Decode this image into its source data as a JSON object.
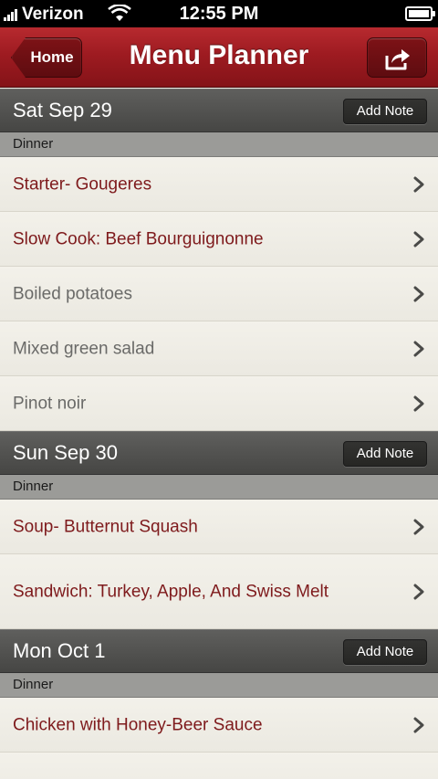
{
  "status_bar": {
    "carrier": "Verizon",
    "time": "12:55 PM"
  },
  "nav": {
    "title": "Menu Planner",
    "home_label": "Home"
  },
  "days": [
    {
      "date": "Sat Sep 29",
      "note_label": "Add Note",
      "meal": "Dinner",
      "items": [
        {
          "label": "Starter- Gougeres",
          "kind": "recipe"
        },
        {
          "label": "Slow Cook: Beef Bourguignonne",
          "kind": "recipe"
        },
        {
          "label": "Boiled potatoes",
          "kind": "plain"
        },
        {
          "label": "Mixed green salad",
          "kind": "plain"
        },
        {
          "label": "Pinot noir",
          "kind": "plain"
        }
      ]
    },
    {
      "date": "Sun Sep 30",
      "note_label": "Add Note",
      "meal": "Dinner",
      "items": [
        {
          "label": "Soup- Butternut Squash",
          "kind": "recipe"
        },
        {
          "label": "Sandwich: Turkey, Apple, And Swiss Melt",
          "kind": "recipe"
        }
      ]
    },
    {
      "date": "Mon Oct 1",
      "note_label": "Add Note",
      "meal": "Dinner",
      "items": [
        {
          "label": "Chicken with Honey-Beer Sauce",
          "kind": "recipe"
        }
      ]
    }
  ],
  "colors": {
    "nav_red": "#9e1b21",
    "recipe_text": "#7e1a1c",
    "plain_text": "#6a6a68",
    "day_header": "#4f4f4d",
    "meal_header": "#9b9b98"
  },
  "icons": {
    "back": "home-back-arrow",
    "share": "share-icon",
    "row": "chevron-right-icon"
  }
}
